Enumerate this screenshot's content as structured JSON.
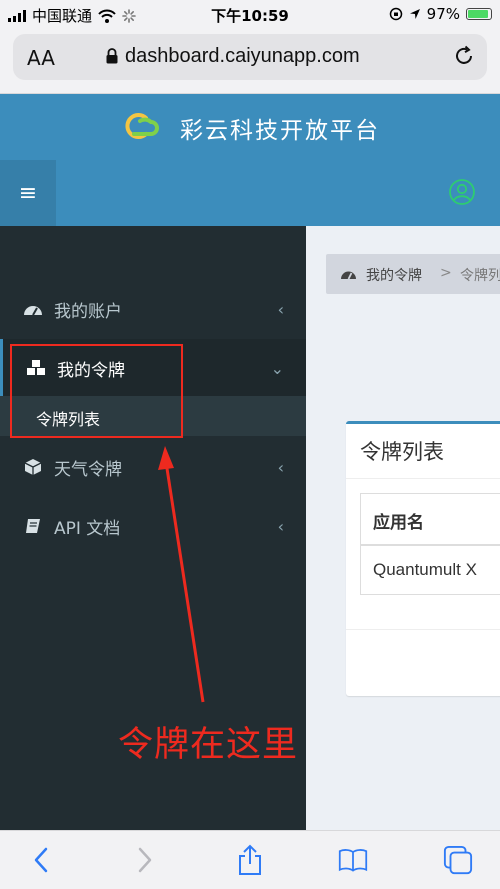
{
  "status_bar": {
    "carrier": "中国联通",
    "time": "下午10:59",
    "battery": "97%"
  },
  "browser": {
    "aa_label": "AA",
    "url": "dashboard.caiyunapp.com"
  },
  "header": {
    "site_title": "彩云科技开放平台"
  },
  "sidebar": {
    "items": [
      {
        "label": "我的账户",
        "chevron": "‹"
      },
      {
        "label": "我的令牌",
        "chevron": "⌄"
      },
      {
        "label": "天气令牌",
        "chevron": "‹"
      },
      {
        "label": "API 文档",
        "chevron": "‹"
      }
    ],
    "submenu": {
      "label": "令牌列表"
    }
  },
  "content": {
    "breadcrumb": [
      "我的令牌",
      "令牌列表"
    ],
    "breadcrumb_sep": ">",
    "box_title": "令牌列表",
    "table": {
      "headers": [
        "应用名"
      ],
      "rows": [
        [
          "Quantumult X"
        ]
      ]
    }
  },
  "annotation": {
    "text": "令牌在这里",
    "color": "#ee2a1f"
  },
  "colors": {
    "brand": "#3c8dbc",
    "sidebar_bg": "#222d32"
  }
}
